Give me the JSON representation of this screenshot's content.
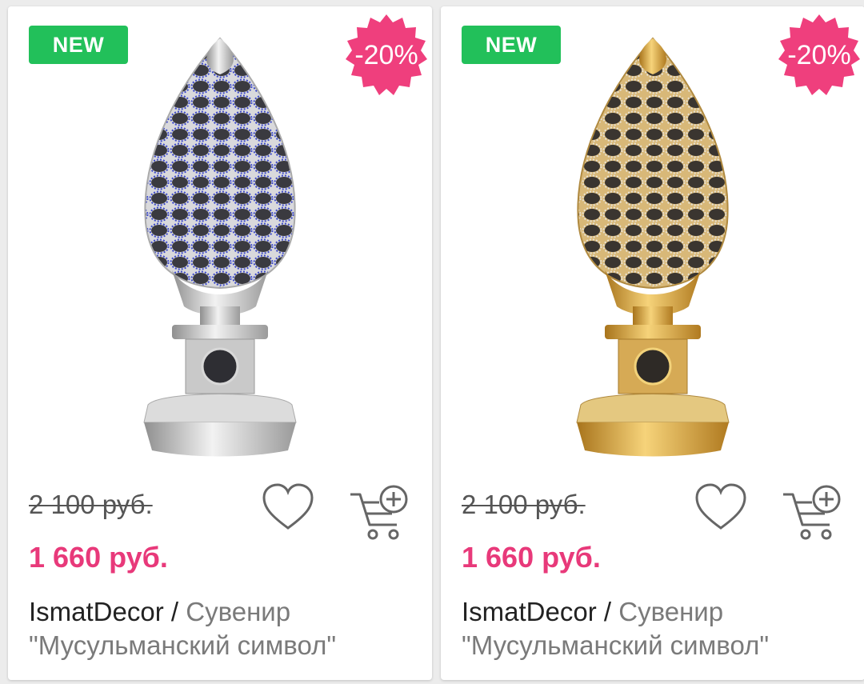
{
  "colors": {
    "new_badge": "#22c05a",
    "sale_badge": "#ef3f7d",
    "sale_price": "#e8397a",
    "old_price": "#555555"
  },
  "products": [
    {
      "badge_new": "NEW",
      "badge_discount": "-20%",
      "old_price": "2 100 руб.",
      "new_price": "1 660 руб.",
      "brand": "IsmatDecor",
      "separator": " / ",
      "title_line1": "Сувенир",
      "title_line2": "\"Мусульманский символ\"",
      "image_variant": "silver"
    },
    {
      "badge_new": "NEW",
      "badge_discount": "-20%",
      "old_price": "2 100 руб.",
      "new_price": "1 660 руб.",
      "brand": "IsmatDecor",
      "separator": " / ",
      "title_line1": "Сувенир",
      "title_line2": "\"Мусульманский символ\"",
      "image_variant": "gold"
    }
  ],
  "icons": {
    "favorite": "heart-icon",
    "cart": "cart-add-icon",
    "discount_badge": "starburst-badge"
  }
}
